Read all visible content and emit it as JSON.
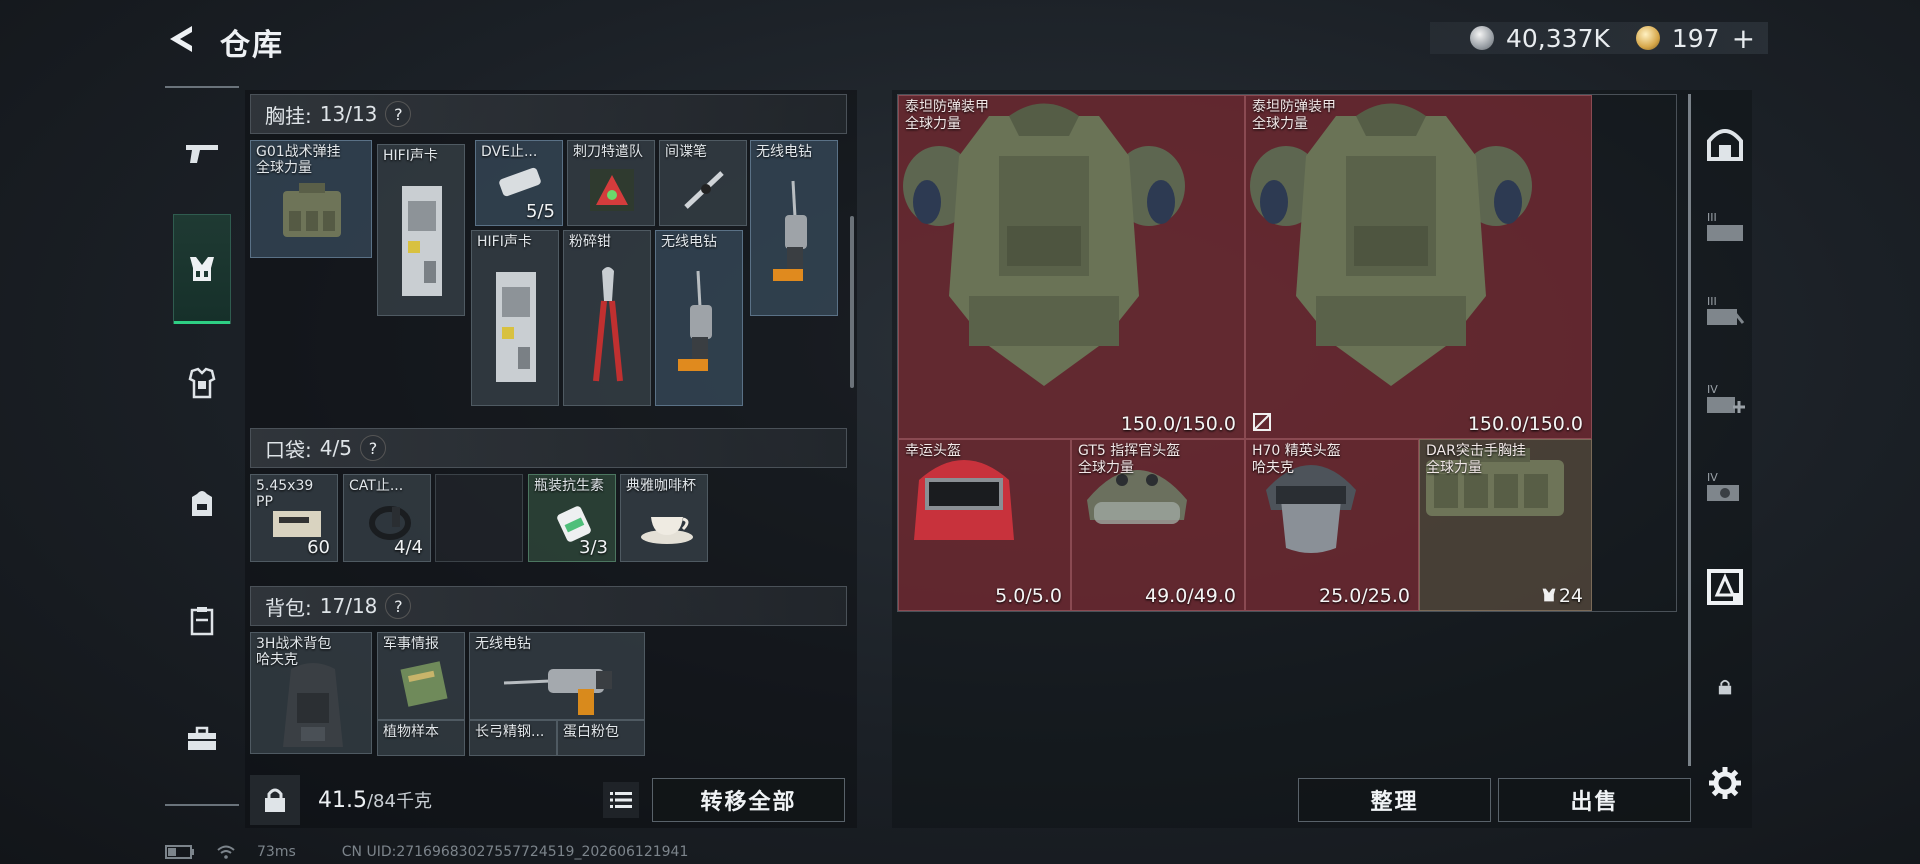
{
  "header": {
    "title": "仓库"
  },
  "currency": {
    "silver": "40,337K",
    "gold": "197",
    "plus": "+"
  },
  "sections": {
    "chest": {
      "label": "胸挂:",
      "count": "13/13",
      "help": "?"
    },
    "pocket": {
      "label": "口袋:",
      "count": "4/5",
      "help": "?"
    },
    "backpack": {
      "label": "背包:",
      "count": "17/18",
      "help": "?"
    }
  },
  "chest_items": [
    {
      "name": "G01战术弹挂",
      "sub": "全球力量"
    },
    {
      "name": "HIFI声卡"
    },
    {
      "name": "DVE止...",
      "count": "5/5"
    },
    {
      "name": "刺刀特遣队"
    },
    {
      "name": "间谍笔"
    },
    {
      "name": "无线电钻"
    },
    {
      "name": "HIFI声卡"
    },
    {
      "name": "粉碎钳"
    },
    {
      "name": "无线电钻"
    }
  ],
  "pocket_items": [
    {
      "name": "5.45x39",
      "sub": "PP",
      "count": "60"
    },
    {
      "name": "CAT止...",
      "count": "4/4"
    },
    {
      "name": "瓶装抗生素",
      "count": "3/3"
    },
    {
      "name": "典雅咖啡杯"
    }
  ],
  "backpack_items": [
    {
      "name": "3H战术背包",
      "sub": "哈夫克"
    },
    {
      "name": "军事情报"
    },
    {
      "name": "无线电钻"
    },
    {
      "name": "植物样本"
    },
    {
      "name": "长弓精钢..."
    },
    {
      "name": "蛋白粉包"
    }
  ],
  "weight": {
    "current": "41.5",
    "max": "/84千克"
  },
  "buttons": {
    "transfer_all": "转移全部",
    "organize": "整理",
    "sell": "出售"
  },
  "stash_items": [
    {
      "name": "泰坦防弹装甲",
      "sub": "全球力量",
      "count": "150.0/150.0"
    },
    {
      "name": "泰坦防弹装甲",
      "sub": "全球力量",
      "count": "150.0/150.0"
    },
    {
      "name": "幸运头盔",
      "count": "5.0/5.0"
    },
    {
      "name": "GT5 指挥官头盔",
      "sub": "全球力量",
      "count": "49.0/49.0"
    },
    {
      "name": "H70 精英头盔",
      "sub": "哈夫克",
      "count": "25.0/25.0"
    },
    {
      "name": "DAR突击手胸挂",
      "sub": "全球力量",
      "count": "24"
    }
  ],
  "status": {
    "ping": "73ms",
    "uid": "CN UID:2716968302755772451​9_202606121941"
  }
}
